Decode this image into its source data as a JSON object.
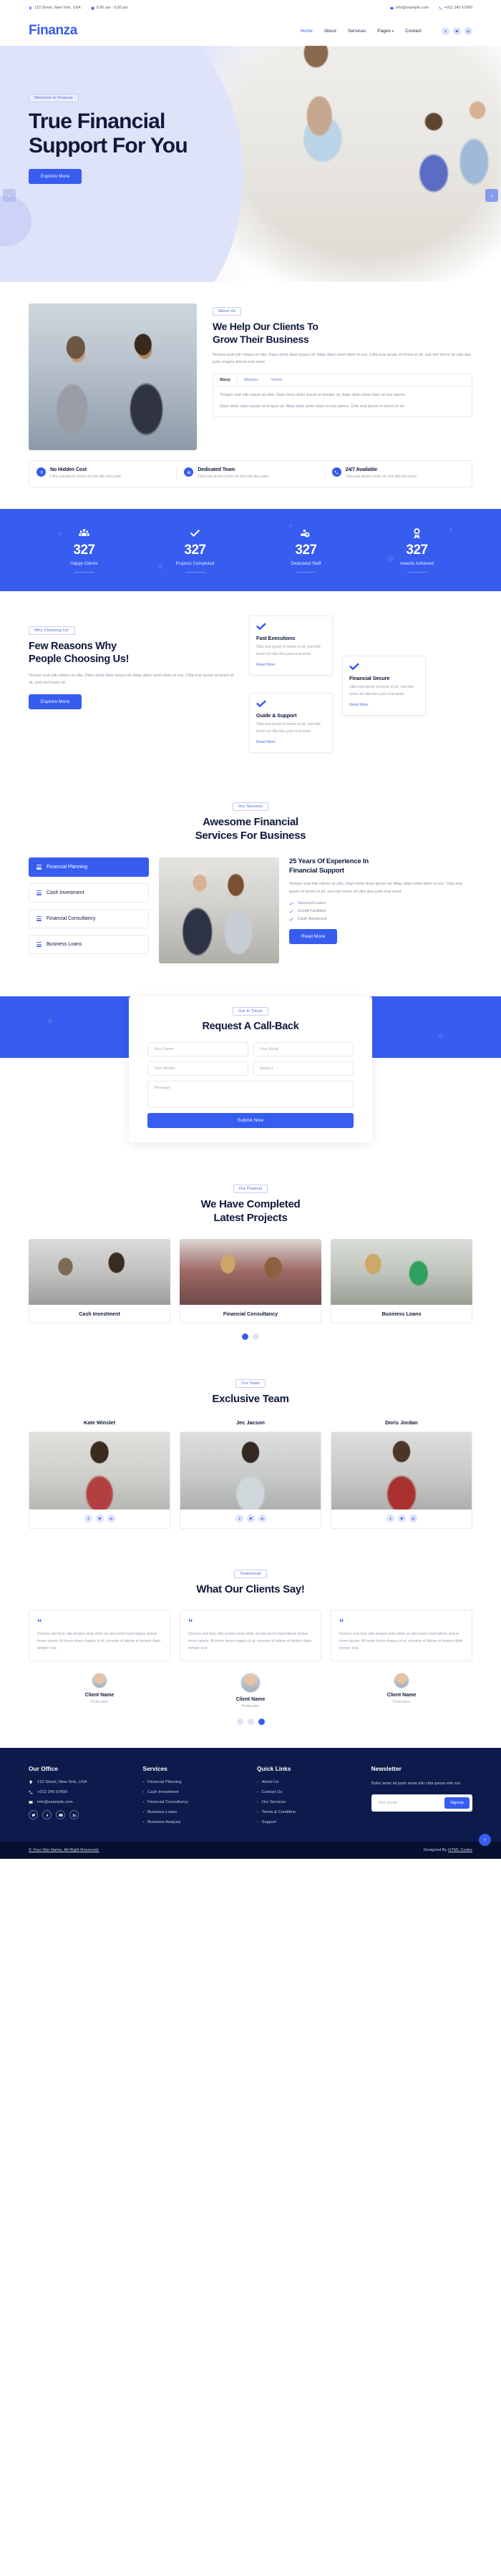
{
  "topbar": {
    "address": "123 Street, New York, USA",
    "hours": "9.00 am - 9.00 pm",
    "email": "info@example.com",
    "phone": "+012 345 67890"
  },
  "header": {
    "logo": "Finanza",
    "nav": [
      {
        "label": "Home",
        "active": true
      },
      {
        "label": "About",
        "active": false
      },
      {
        "label": "Services",
        "active": false
      },
      {
        "label": "Pages",
        "active": false,
        "caret": "▾"
      },
      {
        "label": "Contact",
        "active": false
      }
    ],
    "socials": [
      "facebook-icon",
      "twitter-icon",
      "linkedin-icon"
    ]
  },
  "hero": {
    "badge": "Welcome to Finanza",
    "title_line1": "True Financial",
    "title_line2": "Support For You",
    "cta": "Explore More",
    "prev": "‹",
    "next": "›"
  },
  "about": {
    "badge": "About Us",
    "title_line1": "We Help Our Clients To",
    "title_line2": "Grow Their Business",
    "intro": "Tempor erat elitr rebum at clita. Diam dolor diam ipsum sit. Aliqu diam amet diam et eos. Clita erat ipsum et lorem et sit, sed stet lorem sit clita duo justo magna dolore erat amet",
    "tabs": [
      {
        "label": "Story",
        "active": true
      },
      {
        "label": "Mission",
        "active": false
      },
      {
        "label": "Vision",
        "active": false
      }
    ],
    "tab_p1": "Tempor erat elitr rebum at clita. Diam dolor diam ipsum et tempor sit. Aliqu diam amet diam et eos labore.",
    "tab_p2": "Diam dolor diam ipsum et tempor sit. Aliqu diam amet diam et eos labore. Clita erat ipsum et lorem et sit",
    "features": [
      {
        "icon": "dollar-icon",
        "title": "No Hidden Cost",
        "text": "Clita erat ipsum lorem sit sed stet duo justo"
      },
      {
        "icon": "users-icon",
        "title": "Dedicated Team",
        "text": "Clita erat ipsum lorem sit sed stet duo justo"
      },
      {
        "icon": "phone-icon",
        "title": "24/7 Available",
        "text": "Clita erat ipsum lorem sit sed stet duo justo"
      }
    ]
  },
  "facts": [
    {
      "icon": "users-group-icon",
      "number": "327",
      "label": "Happy Clients"
    },
    {
      "icon": "check-icon",
      "number": "327",
      "label": "Projects Completed"
    },
    {
      "icon": "users-cog-icon",
      "number": "327",
      "label": "Dedicated Staff"
    },
    {
      "icon": "award-icon",
      "number": "327",
      "label": "Awards Achieved"
    }
  ],
  "why": {
    "badge": "Why Choosing Us!",
    "title_line1": "Few Reasons Why",
    "title_line2": "People Choosing Us!",
    "text": "Tempor erat elitr rebum at clita. Diam dolor diam ipsum sit. Aliqu diam amet diam et eos. Clita erat ipsum et lorem et sit, sed stet lorem sit",
    "cta": "Explore More",
    "cards": [
      {
        "title": "Fast Executions",
        "text": "Clita erat ipsum et lorem et sit, sed stet lorem sit clita duo justo erat amet",
        "link": "Read More"
      },
      {
        "title": "Guide & Support",
        "text": "Clita erat ipsum et lorem et sit, sed stet lorem sit clita duo justo erat amet",
        "link": "Read More"
      },
      {
        "title": "Financial Secure",
        "text": "Clita erat ipsum et lorem et sit, sed stet lorem sit clita duo justo erat amet",
        "link": "Read More"
      }
    ]
  },
  "services": {
    "badge": "Our Services",
    "title_line1": "Awesome Financial",
    "title_line2": "Services For Business",
    "items": [
      {
        "label": "Financial Planning",
        "active": true
      },
      {
        "label": "Cash Investment",
        "active": false
      },
      {
        "label": "Financial Consultancy",
        "active": false
      },
      {
        "label": "Business Loans",
        "active": false
      }
    ],
    "panel_title_line1": "25 Years Of Experience In",
    "panel_title_line2": "Financial Support",
    "panel_text": "Tempor erat elitr rebum at clita. Diam dolor diam ipsum sit. Aliqu diam amet diam et eos. Clita erat ipsum et lorem et sit, sed stet lorem sit clita duo justo erat amet.",
    "ticks": [
      "Secured Loans",
      "Credit Facilities",
      "Cash Advanced"
    ],
    "cta": "Read More"
  },
  "callback": {
    "badge": "Get In Touch",
    "title": "Request A Call-Back",
    "name_placeholder": "Your Name",
    "email_placeholder": "Your Email",
    "mobile_placeholder": "Your Mobile",
    "subject_placeholder": "Subject",
    "message_placeholder": "Message",
    "submit": "Submit Now"
  },
  "projects": {
    "badge": "Our Projects",
    "title_line1": "We Have Completed",
    "title_line2": "Latest Projects",
    "items": [
      {
        "label": "Cash Investment"
      },
      {
        "label": "Financial Consultancy"
      },
      {
        "label": "Business Loans"
      }
    ],
    "dots": [
      true,
      false
    ]
  },
  "team": {
    "badge": "Our Team",
    "title": "Exclusive Team",
    "members": [
      {
        "name": "Kate Winslet",
        "socials": [
          "facebook-icon",
          "twitter-icon",
          "linkedin-icon"
        ]
      },
      {
        "name": "Jec Jacson",
        "socials": [
          "facebook-icon",
          "twitter-icon",
          "linkedin-icon"
        ]
      },
      {
        "name": "Doris Jordan",
        "socials": [
          "facebook-icon",
          "twitter-icon",
          "linkedin-icon"
        ]
      }
    ]
  },
  "testimonials": {
    "badge": "Testimonial",
    "title": "What Our Clients Say!",
    "quotes": [
      "Dolores sed duis clita tempor justo dolor sit stet lorem kasd labore dolore lorem ipsum. At lorem lorem magna ut et, nonumy et labore et tempor diam tempor erat.",
      "Dolores sed duis clita tempor justo dolor sit stet lorem kasd labore dolore lorem ipsum. At lorem lorem magna ut et, nonumy et labore et tempor diam tempor erat.",
      "Dolores sed duis clita tempor justo dolor sit stet lorem kasd labore dolore lorem ipsum. At lorem lorem magna ut et, nonumy et labore et tempor diam tempor erat."
    ],
    "people": [
      {
        "name": "Client Name",
        "role": "Profession"
      },
      {
        "name": "Client Name",
        "role": "Profession"
      },
      {
        "name": "Client Name",
        "role": "Profession"
      }
    ],
    "dots": [
      false,
      false,
      true
    ]
  },
  "footer": {
    "office": {
      "title": "Our Office",
      "address": "123 Street, New York, USA",
      "phone": "+012 345 67890",
      "email": "info@example.com",
      "socials": [
        "twitter-icon",
        "facebook-icon",
        "youtube-icon",
        "linkedin-icon"
      ]
    },
    "services": {
      "title": "Services",
      "links": [
        "Financial Planning",
        "Cash Investment",
        "Financial Consultancy",
        "Business Loans",
        "Business Analysis"
      ]
    },
    "quicklinks": {
      "title": "Quick Links",
      "links": [
        "About Us",
        "Contact Us",
        "Our Services",
        "Terms & Condition",
        "Support"
      ]
    },
    "newsletter": {
      "title": "Newsletter",
      "text": "Dolor amet sit justo amet elitr clita ipsum elitr est.",
      "placeholder": "Your email",
      "button": "SignUp"
    },
    "copyright": "© Your Site Name, All Right Reserved.",
    "designed_prefix": "Designed By ",
    "designed_by": "HTML Codex",
    "to_top": "↑"
  },
  "colors": {
    "primary": "#375cf0",
    "dark": "#10183b",
    "footer_bg": "#0d1b4c",
    "copybar_bg": "#07112f",
    "hero_bg": "#dfe3fa"
  }
}
